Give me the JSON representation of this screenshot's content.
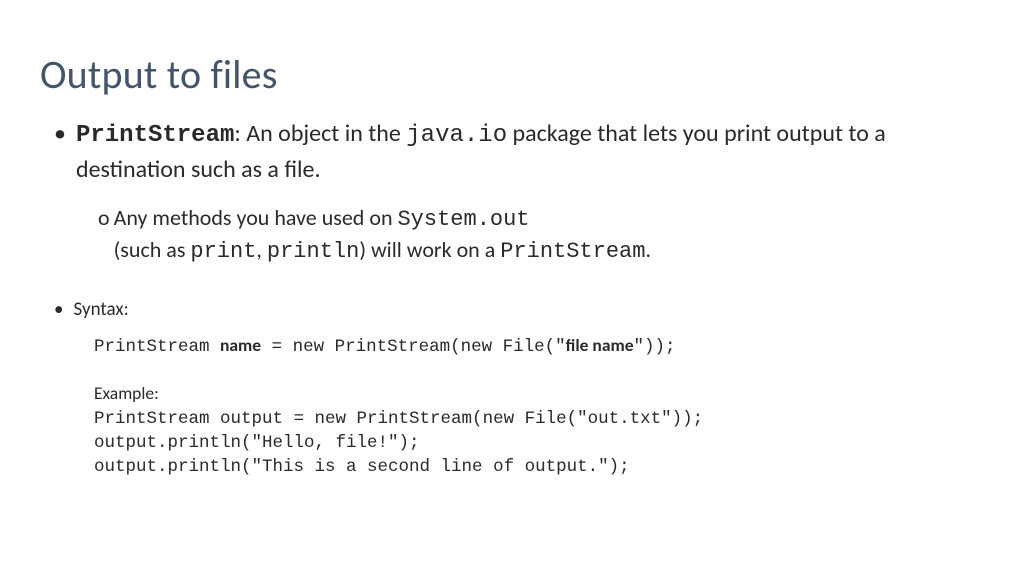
{
  "title": "Output to files",
  "bullet1": {
    "term": "PrintStream",
    "after_term": ": An object in the ",
    "pkg": "java.io",
    "after_pkg": " package that lets you print output to a destination such as a file."
  },
  "sub": {
    "prefix": "o",
    "l1a": "Any methods you have used on ",
    "l1b": "System.out",
    "l2a": "(such as ",
    "l2b": "print",
    "l2c": ", ",
    "l2d": "println",
    "l2e": ") will work on a ",
    "l2f": "PrintStream",
    "l2g": "."
  },
  "syntax_label": "Syntax:",
  "syntax_line": {
    "a": "PrintStream ",
    "name": "name",
    "b": " = new PrintStream(new File(\"",
    "file": "file name",
    "c": "\"));"
  },
  "example_label": "Example:",
  "example_lines": [
    "PrintStream output = new PrintStream(new File(\"out.txt\"));",
    "output.println(\"Hello, file!\");",
    "output.println(\"This is a second line of output.\");"
  ]
}
